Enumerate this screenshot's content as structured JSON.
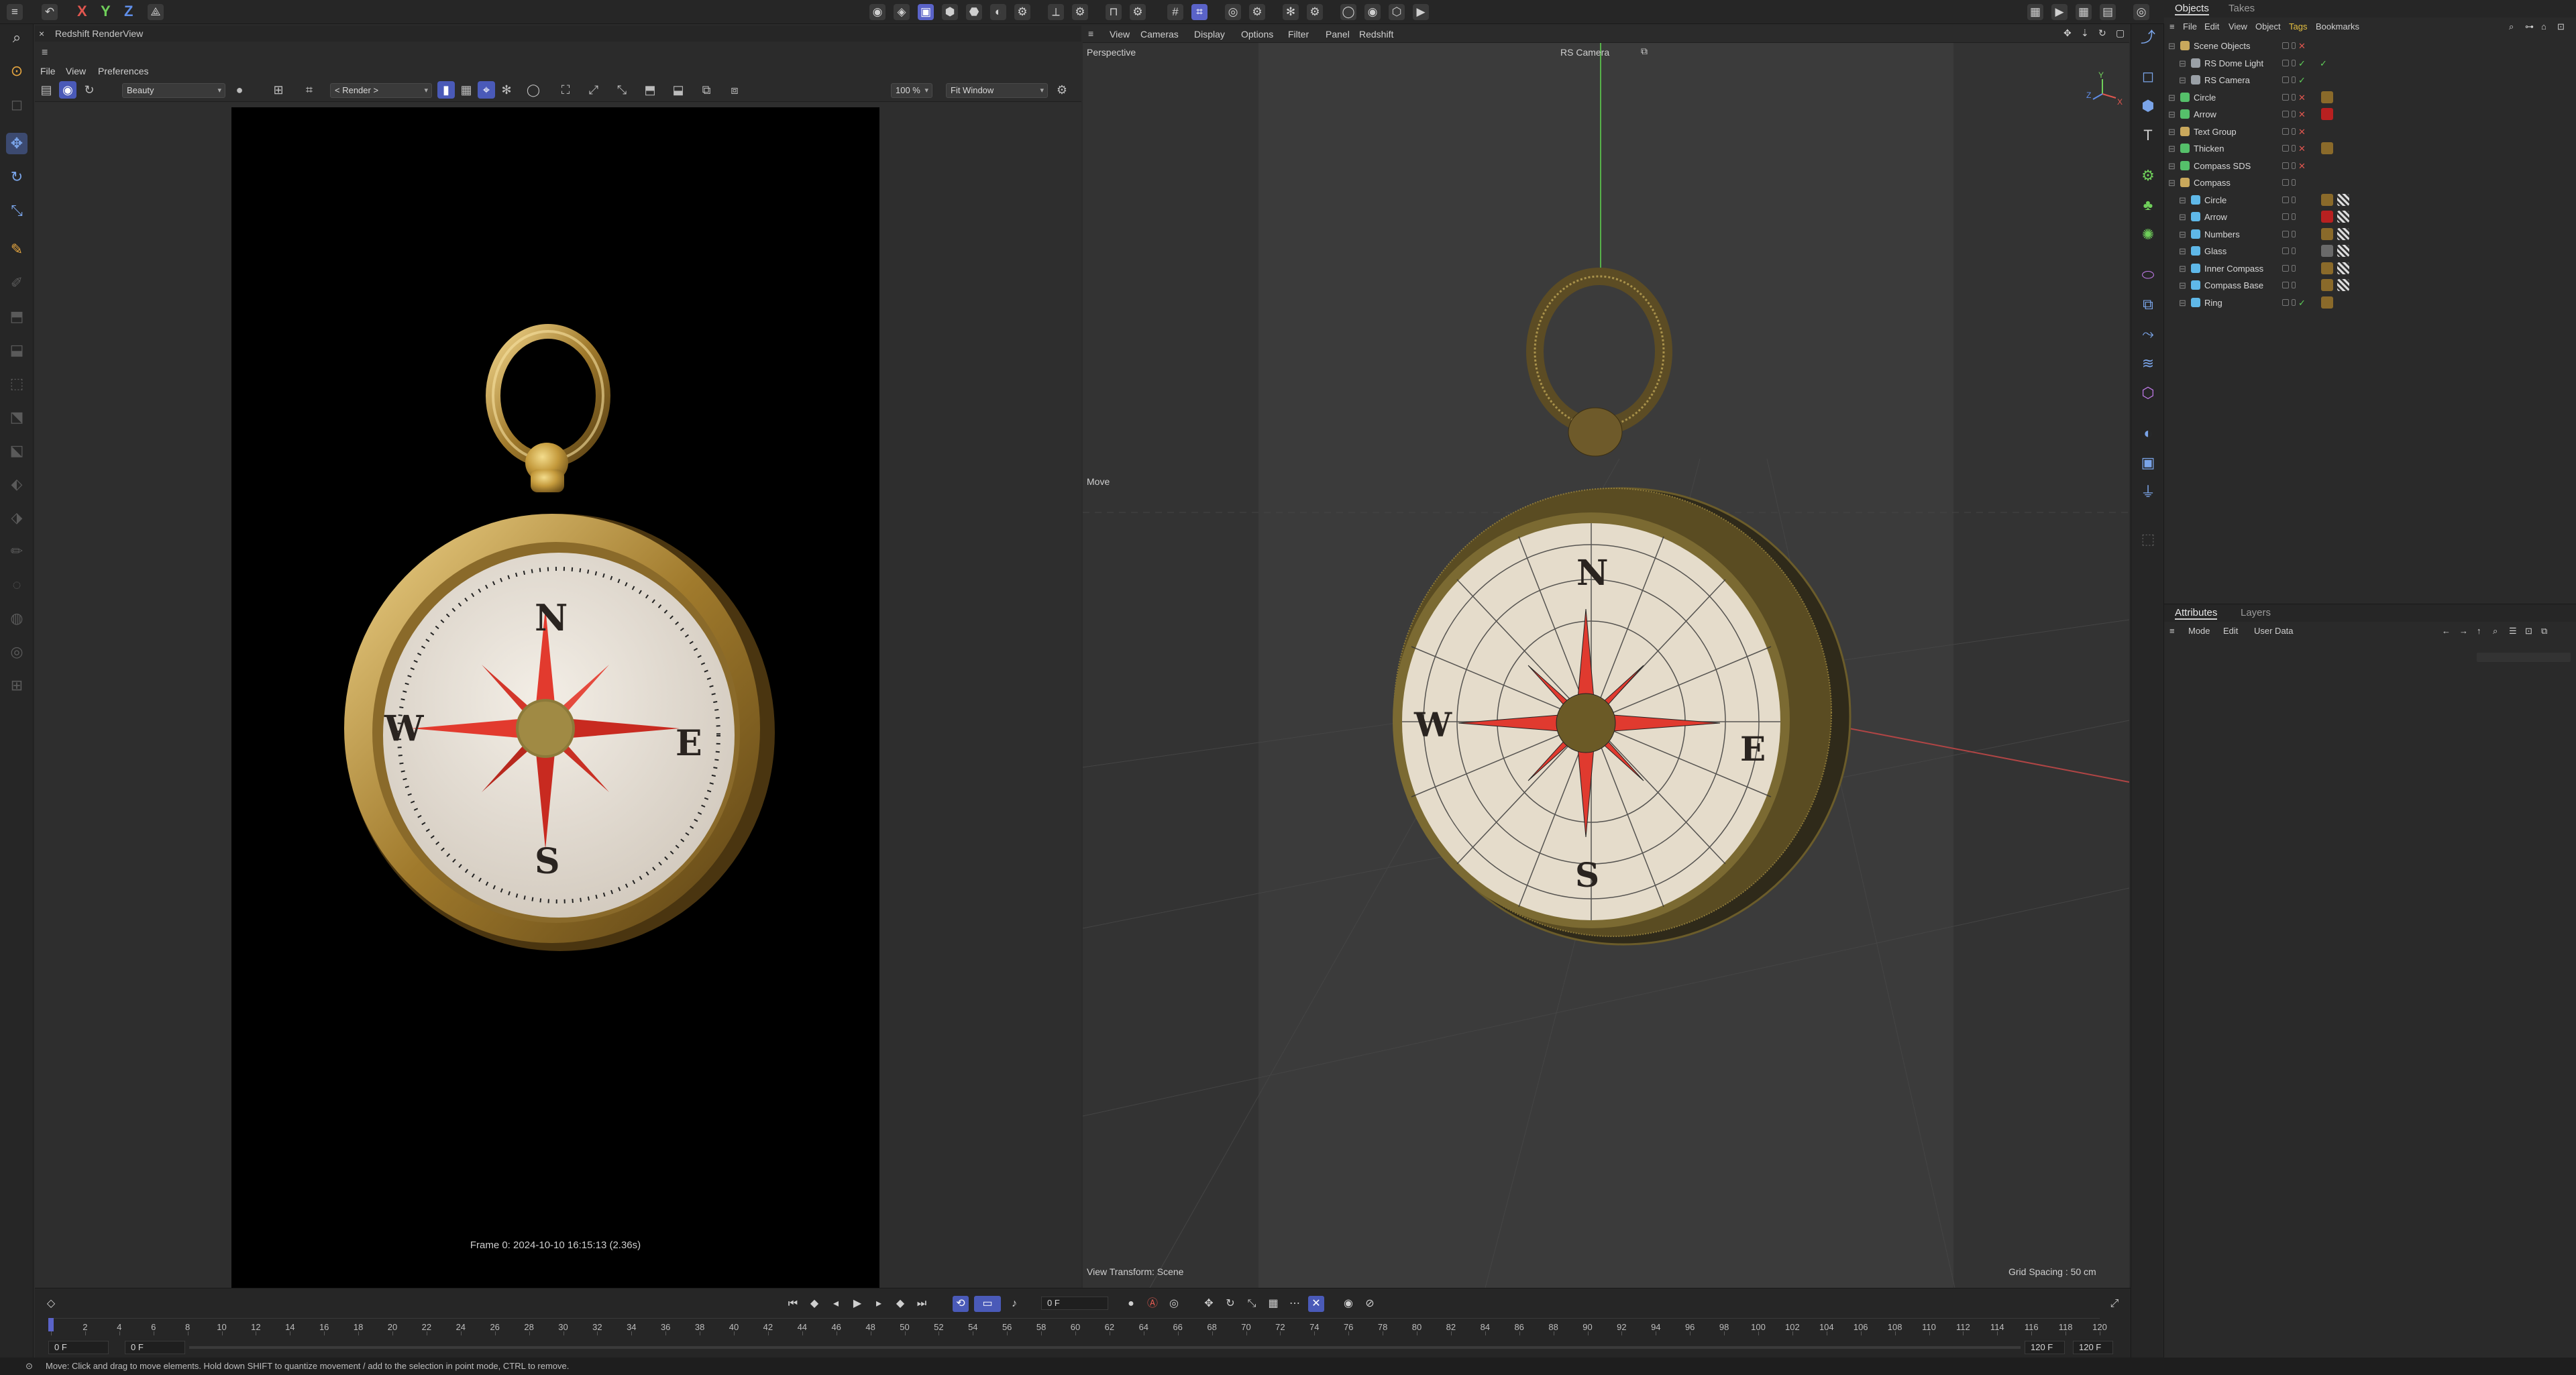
{
  "topbar": {
    "axes": [
      "X",
      "Y",
      "Z"
    ]
  },
  "renderview": {
    "title": "Redshift RenderView",
    "menu": [
      "File",
      "View",
      "Preferences"
    ],
    "aov": "Beauty",
    "camera": "< Render >",
    "zoom": "100 %",
    "fit": "Fit Window",
    "frame_info": "Frame  0:  2024-10-10  16:15:13  (2.36s)",
    "compass_letters": {
      "n": "N",
      "e": "E",
      "s": "S",
      "w": "W"
    }
  },
  "viewport": {
    "menu": [
      "View",
      "Cameras",
      "Display",
      "Options",
      "Filter",
      "Panel",
      "Redshift"
    ],
    "view_name": "Perspective",
    "camera": "RS Camera",
    "tool": "Move",
    "view_transform": "View Transform: Scene",
    "grid_spacing": "Grid Spacing : 50 cm",
    "axis_labels": {
      "y": "Y",
      "z": "Z",
      "x": "X"
    },
    "compass_letters": {
      "n": "N",
      "e": "E",
      "s": "S",
      "w": "W"
    }
  },
  "timeline": {
    "current_frame": "0 F",
    "start_field": "0 F",
    "start_field2": "0 F",
    "end_field": "120 F",
    "end_field2": "120 F",
    "ticks": [
      "0",
      "2",
      "4",
      "6",
      "8",
      "10",
      "12",
      "14",
      "16",
      "18",
      "20",
      "22",
      "24",
      "26",
      "28",
      "30",
      "32",
      "34",
      "36",
      "38",
      "40",
      "42",
      "44",
      "46",
      "48",
      "50",
      "52",
      "54",
      "56",
      "58",
      "60",
      "62",
      "64",
      "66",
      "68",
      "70",
      "72",
      "74",
      "76",
      "78",
      "80",
      "82",
      "84",
      "86",
      "88",
      "90",
      "92",
      "94",
      "96",
      "98",
      "100",
      "102",
      "104",
      "106",
      "108",
      "110",
      "112",
      "114",
      "116",
      "118",
      "120"
    ]
  },
  "statusbar": {
    "text": "Move: Click and drag to move elements. Hold down SHIFT to quantize movement / add to the selection in point mode, CTRL to remove."
  },
  "objects_panel": {
    "tabs": [
      "Objects",
      "Takes"
    ],
    "menu": [
      "File",
      "Edit",
      "View",
      "Object",
      "Tags",
      "Bookmarks"
    ],
    "rows": [
      {
        "name": "Scene Objects",
        "indent": 0,
        "icon": "folder",
        "color": "#c9a85c"
      },
      {
        "name": "RS Dome Light",
        "indent": 1,
        "icon": "light",
        "color": "#9aa0a6"
      },
      {
        "name": "RS Camera",
        "indent": 1,
        "icon": "camera",
        "color": "#9aa0a6"
      },
      {
        "name": "Circle",
        "indent": 0,
        "icon": "generator",
        "color": "#55c06a"
      },
      {
        "name": "Arrow",
        "indent": 0,
        "icon": "generator",
        "color": "#55c06a"
      },
      {
        "name": "Text Group",
        "indent": 0,
        "icon": "group",
        "color": "#c9a85c"
      },
      {
        "name": "Thicken",
        "indent": 0,
        "icon": "generator",
        "color": "#55c06a"
      },
      {
        "name": "Compass SDS",
        "indent": 0,
        "icon": "sds",
        "color": "#55c06a"
      },
      {
        "name": "Compass",
        "indent": 0,
        "icon": "group",
        "color": "#c9a85c"
      },
      {
        "name": "Circle",
        "indent": 1,
        "icon": "mesh",
        "color": "#5fb8e8"
      },
      {
        "name": "Arrow",
        "indent": 1,
        "icon": "mesh",
        "color": "#5fb8e8"
      },
      {
        "name": "Numbers",
        "indent": 1,
        "icon": "mesh",
        "color": "#5fb8e8"
      },
      {
        "name": "Glass",
        "indent": 1,
        "icon": "mesh",
        "color": "#5fb8e8"
      },
      {
        "name": "Inner Compass",
        "indent": 1,
        "icon": "mesh",
        "color": "#5fb8e8"
      },
      {
        "name": "Compass Base",
        "indent": 1,
        "icon": "mesh",
        "color": "#5fb8e8"
      },
      {
        "name": "Ring",
        "indent": 1,
        "icon": "torus",
        "color": "#5fb8e8"
      }
    ]
  },
  "attributes_panel": {
    "tabs": [
      "Attributes",
      "Layers"
    ],
    "menu": [
      "Mode",
      "Edit",
      "User Data"
    ]
  },
  "colors": {
    "accent": "#4a5ab8",
    "gold": "#c9a24a",
    "red_rose": "#e03a2f",
    "dial": "#e9e4dc"
  }
}
